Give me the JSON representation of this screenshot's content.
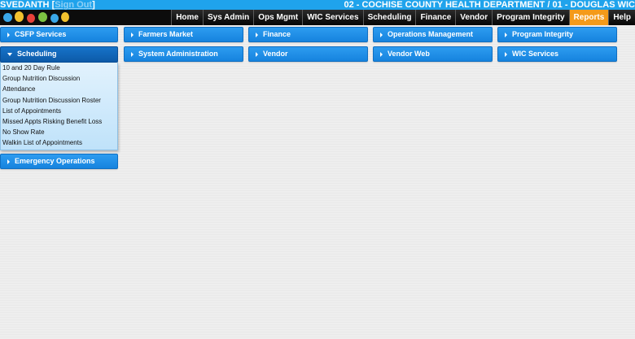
{
  "topbar": {
    "user": "SVEDANTH",
    "user_bracket_open": " [",
    "user_link": "Sign Out",
    "user_bracket_close": "]",
    "department": "02 - COCHISE COUNTY HEALTH DEPARTMENT / 01 - DOUGLAS WIC"
  },
  "nav": {
    "items": [
      {
        "label": "Home"
      },
      {
        "label": "Sys Admin"
      },
      {
        "label": "Ops Mgmt"
      },
      {
        "label": "WIC Services"
      },
      {
        "label": "Scheduling"
      },
      {
        "label": "Finance"
      },
      {
        "label": "Vendor"
      },
      {
        "label": "Program Integrity"
      },
      {
        "label": "Reports",
        "active": true
      },
      {
        "label": "Help"
      }
    ]
  },
  "tiles": {
    "csfp": "CSFP Services",
    "farmers_market": "Farmers Market",
    "finance": "Finance",
    "operations_management": "Operations Management",
    "program_integrity": "Program Integrity",
    "scheduling": "Scheduling",
    "system_administration": "System Administration",
    "vendor": "Vendor",
    "vendor_web": "Vendor Web",
    "wic_services": "WIC Services",
    "emergency_operations": "Emergency Operations"
  },
  "scheduling_reports": [
    "10 and 20 Day Rule",
    "Group Nutrition Discussion",
    "Attendance",
    "Group Nutrition Discussion Roster",
    "List of Appointments",
    "Missed Appts Risking Benefit Loss",
    "No Show Rate",
    "Walkin List of Appointments"
  ],
  "colors": {
    "top_strip": "#1fa3ec",
    "nav_bg": "#0c0c0c",
    "active_tab": "#f49a1a",
    "tile": "#1f8fe6",
    "dropdown_bg": "#d4ecfc"
  }
}
